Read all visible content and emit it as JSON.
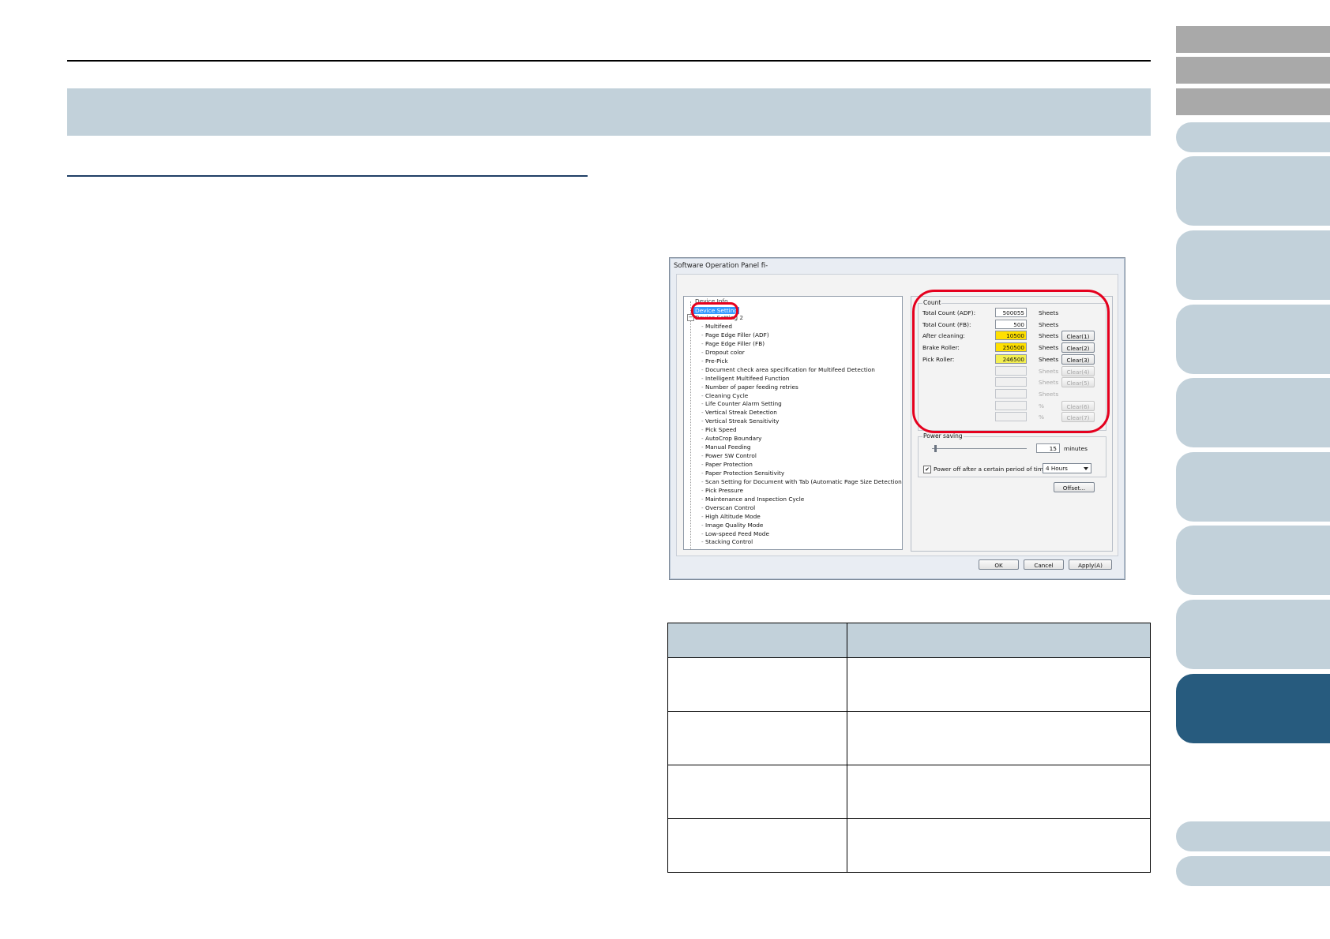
{
  "dialog": {
    "title": "Software Operation Panel fi-",
    "tree": {
      "top_item": "Device Info",
      "selected_item": "Device Setting",
      "group_item": "Device Setting 2",
      "expander": "−",
      "items": [
        "Multifeed",
        "Page Edge Filler (ADF)",
        "Page Edge Filler (FB)",
        "Dropout color",
        "Pre-Pick",
        "Document check area specification for Multifeed Detection",
        "Intelligent Multifeed Function",
        "Number of paper feeding retries",
        "Cleaning Cycle",
        "Life Counter Alarm Setting",
        "Vertical Streak Detection",
        "Vertical Streak Sensitivity",
        "Pick Speed",
        "AutoCrop Boundary",
        "Manual Feeding",
        "Power SW Control",
        "Paper Protection",
        "Paper Protection Sensitivity",
        "Scan Setting for Document with Tab (Automatic Page Size Detection)",
        "Pick Pressure",
        "Maintenance and Inspection Cycle",
        "Overscan Control",
        "High Altitude Mode",
        "Image Quality Mode",
        "Low-speed Feed Mode",
        "Stacking Control"
      ]
    },
    "count": {
      "group_label": "Count",
      "rows": [
        {
          "label": "Total Count (ADF):",
          "value": "500055",
          "unit": "Sheets",
          "button": ""
        },
        {
          "label": "Total Count (FB):",
          "value": "500",
          "unit": "Sheets",
          "button": ""
        },
        {
          "label": "After cleaning:",
          "value": "10500",
          "unit": "Sheets",
          "button": "Clear(1)"
        },
        {
          "label": "Brake Roller:",
          "value": "250500",
          "unit": "Sheets",
          "button": "Clear(2)"
        },
        {
          "label": "Pick Roller:",
          "value": "246500",
          "unit": "Sheets",
          "button": "Clear(3)"
        },
        {
          "label": "",
          "value": "",
          "unit": "Sheets",
          "button": "Clear(4)"
        },
        {
          "label": "",
          "value": "",
          "unit": "Sheets",
          "button": "Clear(5)"
        },
        {
          "label": "",
          "value": "",
          "unit": "Sheets",
          "button": ""
        },
        {
          "label": "",
          "value": "",
          "unit": "%",
          "button": "Clear(6)"
        },
        {
          "label": "",
          "value": "",
          "unit": "%",
          "button": "Clear(7)"
        }
      ]
    },
    "power_saving": {
      "group_label": "Power saving",
      "value": "15",
      "unit": "minutes"
    },
    "power_off": {
      "checkbox_mark": "✔",
      "label": "Power off after a certain period of time",
      "selected": "4 Hours"
    },
    "offset_button": "Offset...",
    "ok_button": "OK",
    "cancel_button": "Cancel",
    "apply_button": "Apply(A)"
  },
  "colors": {
    "accent_band": "#c2d1da",
    "active_tab": "#275b7e",
    "highlight_red": "#e5001e",
    "yellow_counter": "#ffe000"
  }
}
